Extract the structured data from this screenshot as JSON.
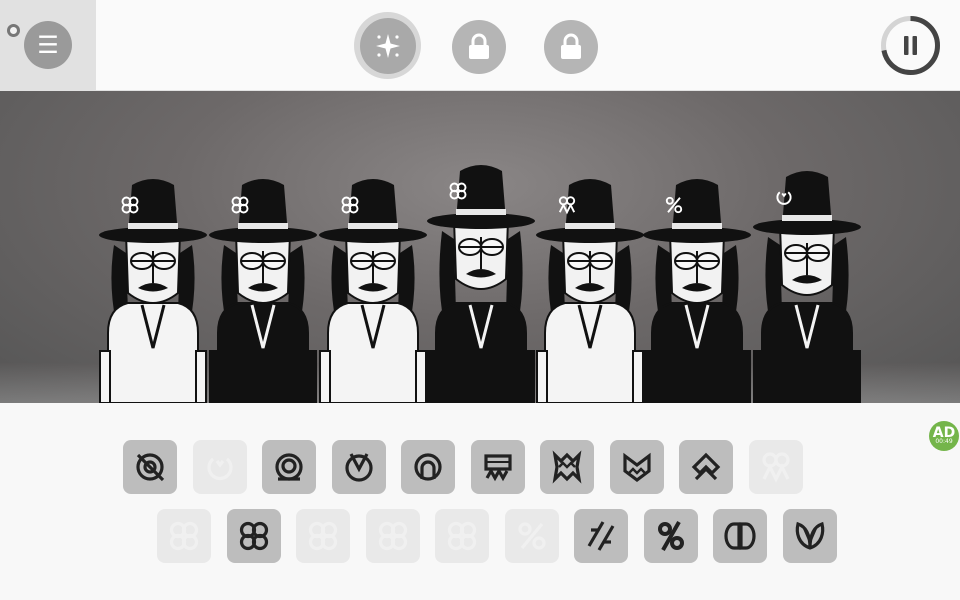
{
  "menu": {
    "icon": "hamburger-icon",
    "glyph": "☰"
  },
  "mode_buttons": [
    {
      "name": "bonus-mode",
      "icon": "sparkle-icon",
      "state": "active"
    },
    {
      "name": "locked-mode-1",
      "icon": "lock-icon",
      "state": "locked"
    },
    {
      "name": "locked-mode-2",
      "icon": "lock-icon",
      "state": "locked"
    }
  ],
  "pause": {
    "icon": "pause-icon",
    "progress": 0.72
  },
  "ad_badge": {
    "label": "AD",
    "sublabel": "00:49"
  },
  "performers": [
    {
      "name": "performer-1",
      "hat_icon": "clover"
    },
    {
      "name": "performer-2",
      "hat_icon": "clover"
    },
    {
      "name": "performer-3",
      "hat_icon": "clover"
    },
    {
      "name": "performer-4",
      "hat_icon": "clover"
    },
    {
      "name": "performer-5",
      "hat_icon": "chevron-loops"
    },
    {
      "name": "performer-6",
      "hat_icon": "percent"
    },
    {
      "name": "performer-7",
      "hat_icon": "power"
    }
  ],
  "sound_palette": {
    "row1": [
      {
        "icon": "beat-slash",
        "state": "available"
      },
      {
        "icon": "power",
        "state": "in-use"
      },
      {
        "icon": "ring-double",
        "state": "available"
      },
      {
        "icon": "ring-v",
        "state": "available"
      },
      {
        "icon": "ring-arch",
        "state": "available"
      },
      {
        "icon": "board-zigzag",
        "state": "available"
      },
      {
        "icon": "star-zigzag",
        "state": "available"
      },
      {
        "icon": "heart-zigzag",
        "state": "available"
      },
      {
        "icon": "diamond-loop",
        "state": "available"
      },
      {
        "icon": "chevron-loops",
        "state": "in-use"
      }
    ],
    "row2": [
      {
        "icon": "clover",
        "state": "in-use"
      },
      {
        "icon": "clover",
        "state": "available"
      },
      {
        "icon": "clover",
        "state": "in-use"
      },
      {
        "icon": "clover",
        "state": "in-use"
      },
      {
        "icon": "clover",
        "state": "in-use"
      },
      {
        "icon": "percent",
        "state": "in-use"
      },
      {
        "icon": "percent-hatched",
        "state": "available"
      },
      {
        "icon": "percent-bold",
        "state": "available"
      },
      {
        "icon": "double-d",
        "state": "available"
      },
      {
        "icon": "leaf-v",
        "state": "available"
      }
    ]
  }
}
